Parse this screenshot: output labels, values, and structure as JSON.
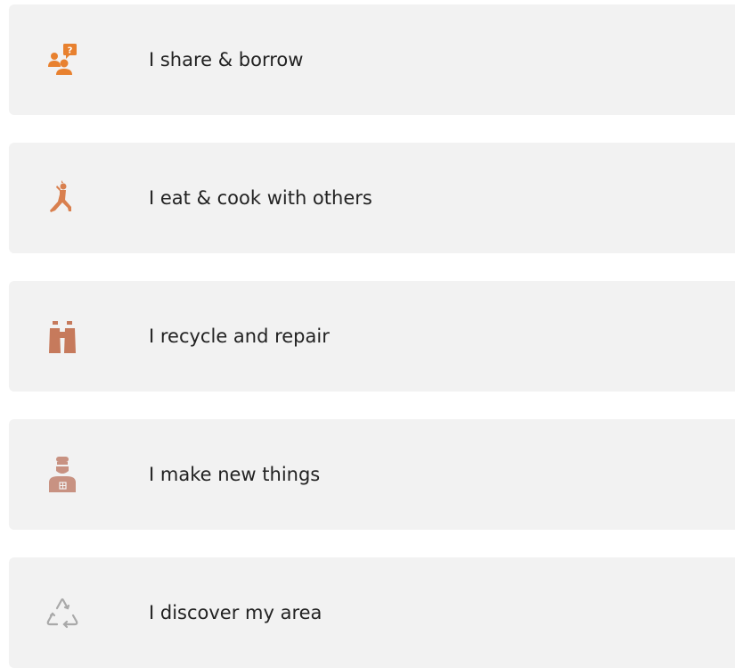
{
  "colors": {
    "card_background": "#f2f2f2",
    "text": "#222222",
    "icon_orange": "#e8812f",
    "icon_terracotta": "#d9804f",
    "icon_brown": "#c67a5c",
    "icon_muted": "#c89282",
    "icon_gray": "#a9a9a9"
  },
  "items": [
    {
      "label": "I share & borrow",
      "icon": "people-question-icon"
    },
    {
      "label": "I eat & cook with others",
      "icon": "yoga-pose-icon"
    },
    {
      "label": "I recycle and repair",
      "icon": "binoculars-icon"
    },
    {
      "label": "I make new things",
      "icon": "chef-icon"
    },
    {
      "label": "I discover my area",
      "icon": "recycle-icon"
    }
  ]
}
